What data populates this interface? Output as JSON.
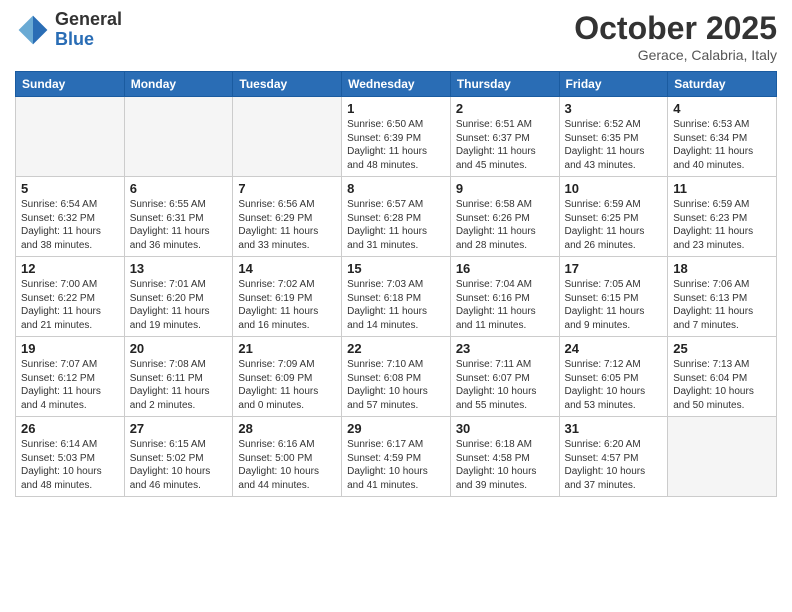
{
  "header": {
    "logo_general": "General",
    "logo_blue": "Blue",
    "month_title": "October 2025",
    "location": "Gerace, Calabria, Italy"
  },
  "weekdays": [
    "Sunday",
    "Monday",
    "Tuesday",
    "Wednesday",
    "Thursday",
    "Friday",
    "Saturday"
  ],
  "weeks": [
    [
      {
        "day": "",
        "info": ""
      },
      {
        "day": "",
        "info": ""
      },
      {
        "day": "",
        "info": ""
      },
      {
        "day": "1",
        "info": "Sunrise: 6:50 AM\nSunset: 6:39 PM\nDaylight: 11 hours\nand 48 minutes."
      },
      {
        "day": "2",
        "info": "Sunrise: 6:51 AM\nSunset: 6:37 PM\nDaylight: 11 hours\nand 45 minutes."
      },
      {
        "day": "3",
        "info": "Sunrise: 6:52 AM\nSunset: 6:35 PM\nDaylight: 11 hours\nand 43 minutes."
      },
      {
        "day": "4",
        "info": "Sunrise: 6:53 AM\nSunset: 6:34 PM\nDaylight: 11 hours\nand 40 minutes."
      }
    ],
    [
      {
        "day": "5",
        "info": "Sunrise: 6:54 AM\nSunset: 6:32 PM\nDaylight: 11 hours\nand 38 minutes."
      },
      {
        "day": "6",
        "info": "Sunrise: 6:55 AM\nSunset: 6:31 PM\nDaylight: 11 hours\nand 36 minutes."
      },
      {
        "day": "7",
        "info": "Sunrise: 6:56 AM\nSunset: 6:29 PM\nDaylight: 11 hours\nand 33 minutes."
      },
      {
        "day": "8",
        "info": "Sunrise: 6:57 AM\nSunset: 6:28 PM\nDaylight: 11 hours\nand 31 minutes."
      },
      {
        "day": "9",
        "info": "Sunrise: 6:58 AM\nSunset: 6:26 PM\nDaylight: 11 hours\nand 28 minutes."
      },
      {
        "day": "10",
        "info": "Sunrise: 6:59 AM\nSunset: 6:25 PM\nDaylight: 11 hours\nand 26 minutes."
      },
      {
        "day": "11",
        "info": "Sunrise: 6:59 AM\nSunset: 6:23 PM\nDaylight: 11 hours\nand 23 minutes."
      }
    ],
    [
      {
        "day": "12",
        "info": "Sunrise: 7:00 AM\nSunset: 6:22 PM\nDaylight: 11 hours\nand 21 minutes."
      },
      {
        "day": "13",
        "info": "Sunrise: 7:01 AM\nSunset: 6:20 PM\nDaylight: 11 hours\nand 19 minutes."
      },
      {
        "day": "14",
        "info": "Sunrise: 7:02 AM\nSunset: 6:19 PM\nDaylight: 11 hours\nand 16 minutes."
      },
      {
        "day": "15",
        "info": "Sunrise: 7:03 AM\nSunset: 6:18 PM\nDaylight: 11 hours\nand 14 minutes."
      },
      {
        "day": "16",
        "info": "Sunrise: 7:04 AM\nSunset: 6:16 PM\nDaylight: 11 hours\nand 11 minutes."
      },
      {
        "day": "17",
        "info": "Sunrise: 7:05 AM\nSunset: 6:15 PM\nDaylight: 11 hours\nand 9 minutes."
      },
      {
        "day": "18",
        "info": "Sunrise: 7:06 AM\nSunset: 6:13 PM\nDaylight: 11 hours\nand 7 minutes."
      }
    ],
    [
      {
        "day": "19",
        "info": "Sunrise: 7:07 AM\nSunset: 6:12 PM\nDaylight: 11 hours\nand 4 minutes."
      },
      {
        "day": "20",
        "info": "Sunrise: 7:08 AM\nSunset: 6:11 PM\nDaylight: 11 hours\nand 2 minutes."
      },
      {
        "day": "21",
        "info": "Sunrise: 7:09 AM\nSunset: 6:09 PM\nDaylight: 11 hours\nand 0 minutes."
      },
      {
        "day": "22",
        "info": "Sunrise: 7:10 AM\nSunset: 6:08 PM\nDaylight: 10 hours\nand 57 minutes."
      },
      {
        "day": "23",
        "info": "Sunrise: 7:11 AM\nSunset: 6:07 PM\nDaylight: 10 hours\nand 55 minutes."
      },
      {
        "day": "24",
        "info": "Sunrise: 7:12 AM\nSunset: 6:05 PM\nDaylight: 10 hours\nand 53 minutes."
      },
      {
        "day": "25",
        "info": "Sunrise: 7:13 AM\nSunset: 6:04 PM\nDaylight: 10 hours\nand 50 minutes."
      }
    ],
    [
      {
        "day": "26",
        "info": "Sunrise: 6:14 AM\nSunset: 5:03 PM\nDaylight: 10 hours\nand 48 minutes."
      },
      {
        "day": "27",
        "info": "Sunrise: 6:15 AM\nSunset: 5:02 PM\nDaylight: 10 hours\nand 46 minutes."
      },
      {
        "day": "28",
        "info": "Sunrise: 6:16 AM\nSunset: 5:00 PM\nDaylight: 10 hours\nand 44 minutes."
      },
      {
        "day": "29",
        "info": "Sunrise: 6:17 AM\nSunset: 4:59 PM\nDaylight: 10 hours\nand 41 minutes."
      },
      {
        "day": "30",
        "info": "Sunrise: 6:18 AM\nSunset: 4:58 PM\nDaylight: 10 hours\nand 39 minutes."
      },
      {
        "day": "31",
        "info": "Sunrise: 6:20 AM\nSunset: 4:57 PM\nDaylight: 10 hours\nand 37 minutes."
      },
      {
        "day": "",
        "info": ""
      }
    ]
  ]
}
